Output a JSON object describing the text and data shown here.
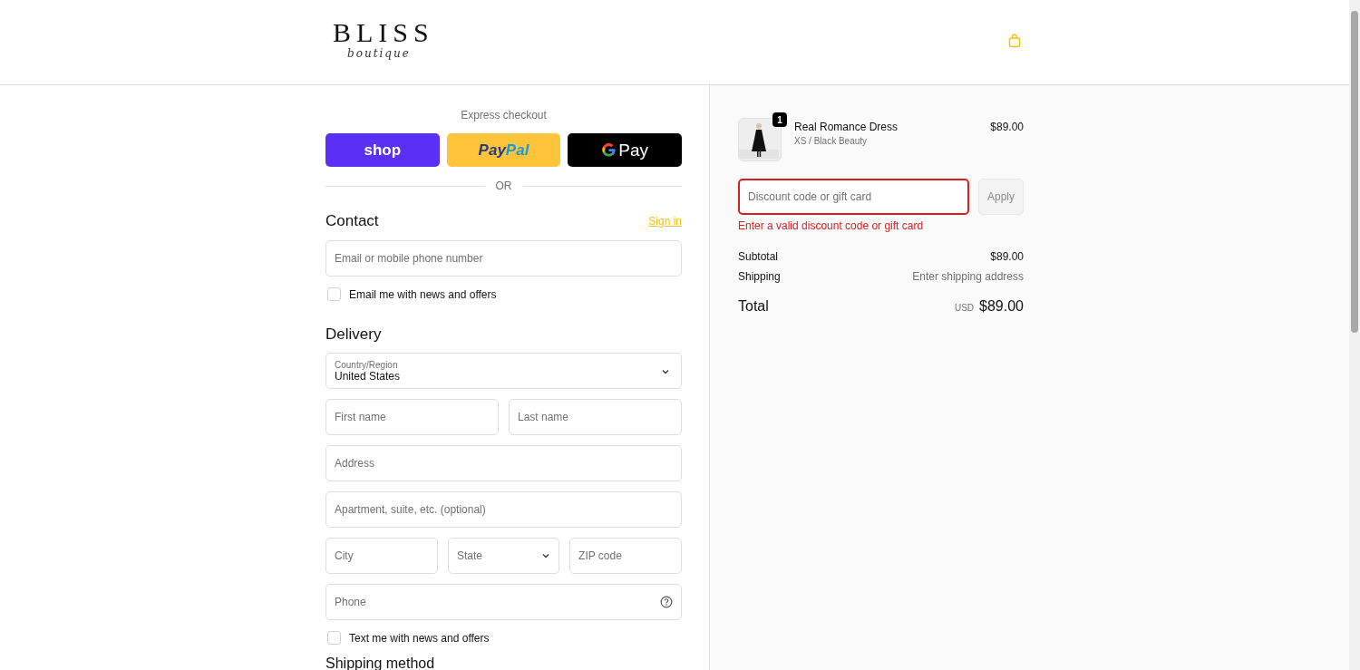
{
  "header": {
    "logo_title": "BLISS",
    "logo_subtitle": "boutique"
  },
  "express": {
    "title": "Express checkout",
    "buttons": [
      {
        "kind": "shop",
        "label": "shop"
      },
      {
        "kind": "paypal",
        "label_a": "Pay",
        "label_b": "Pal"
      },
      {
        "kind": "gpay",
        "label": "Pay"
      }
    ],
    "divider": "OR"
  },
  "contact": {
    "heading": "Contact",
    "sign_in": "Sign in",
    "email_placeholder": "Email or mobile phone number",
    "newsletter": {
      "label": "Email me with news and offers",
      "checked": false
    }
  },
  "delivery": {
    "heading": "Delivery",
    "country": {
      "label": "Country/Region",
      "value": "United States"
    },
    "first_name": {
      "placeholder": "First name"
    },
    "last_name": {
      "placeholder": "Last name"
    },
    "address": {
      "placeholder": "Address"
    },
    "apartment": {
      "placeholder": "Apartment, suite, etc. (optional)"
    },
    "city": {
      "placeholder": "City"
    },
    "state": "State",
    "zip": {
      "placeholder": "ZIP code"
    },
    "phone": "Phone",
    "sms": {
      "label": "Text me with news and offers",
      "checked": false
    }
  },
  "shipping_method": {
    "heading": "Shipping method"
  },
  "summary": {
    "item": {
      "name": "Real Romance Dress",
      "variant": "XS / Black Beauty",
      "price": "$89.00",
      "quantity": "1"
    },
    "discount": {
      "placeholder": "Discount code or gift card",
      "invalid": true,
      "error": "Enter a valid discount code or gift card",
      "button": "Apply"
    },
    "subtotal": {
      "label": "Subtotal",
      "value": "$89.00"
    },
    "shipping": {
      "label": "Shipping",
      "value": "Enter shipping address"
    },
    "total": {
      "label": "Total",
      "currency": "USD",
      "value": "$89.00"
    }
  }
}
